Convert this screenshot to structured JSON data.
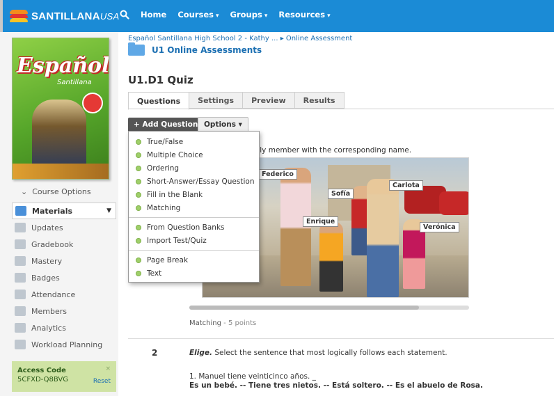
{
  "header": {
    "logo_main": "SANTILLANA",
    "logo_suffix": "USA",
    "nav": [
      {
        "label": "Home",
        "caret": ""
      },
      {
        "label": "Courses",
        "caret": "▾"
      },
      {
        "label": "Groups",
        "caret": "▾"
      },
      {
        "label": "Resources",
        "caret": "▾"
      }
    ],
    "search_icon": "search-icon",
    "accent": "#1b8bd6"
  },
  "sidebar": {
    "book_title": "Español",
    "book_subtitle": "Santillana",
    "course_options": "Course Options",
    "items": [
      {
        "label": "Materials",
        "icon": "materials-icon",
        "active": true
      },
      {
        "label": "Updates",
        "icon": "updates-icon"
      },
      {
        "label": "Gradebook",
        "icon": "gradebook-icon"
      },
      {
        "label": "Mastery",
        "icon": "mastery-icon"
      },
      {
        "label": "Badges",
        "icon": "badges-icon"
      },
      {
        "label": "Attendance",
        "icon": "attendance-icon"
      },
      {
        "label": "Members",
        "icon": "members-icon"
      },
      {
        "label": "Analytics",
        "icon": "analytics-icon"
      },
      {
        "label": "Workload Planning",
        "icon": "workload-planning-icon"
      }
    ],
    "access": {
      "label": "Access Code",
      "code": "5CFXD-Q8BVG",
      "reset": "Reset",
      "close": "×"
    }
  },
  "main": {
    "breadcrumb": "Español Santillana High School 2 - Kathy ...  ▸ Online Assessment",
    "folder_title": "U1 Online Assessments",
    "page_title": "U1.D1 Quiz",
    "tabs": [
      "Questions",
      "Settings",
      "Preview",
      "Results"
    ],
    "add_question": "+ Add Question",
    "options": "Options ▾",
    "q1": {
      "text": "h family member with the corresponding name.",
      "labels": [
        "Federico",
        "Sofía",
        "Carlota",
        "Enrique",
        "Verónica"
      ],
      "meta_type": "Matching",
      "meta_points": "- 5 points"
    },
    "q2": {
      "number": "2",
      "prompt_bold": "Elige.",
      "prompt_rest": " Select the sentence that most logically follows each statement.",
      "statement": "1. Manuel tiene veinticinco años. _",
      "choices": "Es un bebé. -- Tiene tres nietos. -- Está soltero. -- Es el abuelo de Rosa."
    }
  },
  "dropdown": {
    "group1": [
      "True/False",
      "Multiple Choice",
      "Ordering",
      "Short-Answer/Essay Question",
      "Fill in the Blank",
      "Matching"
    ],
    "group2": [
      "From Question Banks",
      "Import Test/Quiz"
    ],
    "group3": [
      "Page Break",
      "Text"
    ]
  }
}
